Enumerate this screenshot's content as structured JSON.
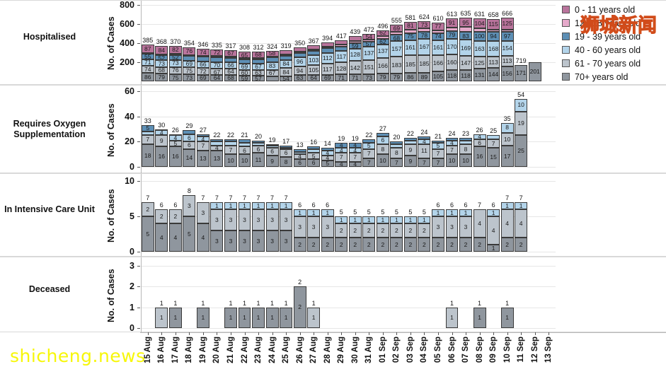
{
  "legend": {
    "title": "",
    "items": [
      {
        "label": "0 - 11 years old",
        "color": "#b9749c"
      },
      {
        "label": "12 - 18 years old",
        "color": "#e6aacb"
      },
      {
        "label": "19 - 39 years old",
        "color": "#5d8fb5"
      },
      {
        "label": "40 - 60 years old",
        "color": "#b3d4ea"
      },
      {
        "label": "61 - 70 years old",
        "color": "#bcc4cc"
      },
      {
        "label": "70+ years old",
        "color": "#8f969e"
      }
    ]
  },
  "watermarks": {
    "chinese": "狮城新闻",
    "site": "shicheng.news"
  },
  "panels": [
    {
      "title": "Hospitalised",
      "ylabel": "No. of Cases"
    },
    {
      "title": "Requires Oxygen Supplementation",
      "ylabel": "No. of Cases"
    },
    {
      "title": "In Intensive Care Unit",
      "ylabel": "No. of Cases"
    },
    {
      "title": "Deceased",
      "ylabel": "No. of Cases"
    }
  ],
  "chart_data": [
    {
      "type": "bar",
      "stacked": true,
      "title": "Hospitalised",
      "xlabel": "",
      "ylabel": "No. of Cases",
      "ylim": [
        0,
        800
      ],
      "yticks": [
        200,
        400,
        600,
        800
      ],
      "grid": true,
      "legend_position": "right",
      "categories": [
        "15 Aug",
        "16 Aug",
        "17 Aug",
        "18 Aug",
        "19 Aug",
        "20 Aug",
        "21 Aug",
        "22 Aug",
        "23 Aug",
        "24 Aug",
        "25 Aug",
        "26 Aug",
        "27 Aug",
        "28 Aug",
        "29 Aug",
        "30 Aug",
        "31 Aug",
        "01 Sep",
        "02 Sep",
        "03 Sep",
        "04 Sep",
        "05 Sep",
        "06 Sep",
        "07 Sep",
        "08 Sep",
        "09 Sep",
        "10 Sep",
        "11 Sep",
        "12 Sep",
        "13 Sep"
      ],
      "series": [
        {
          "name": "0 - 11 years old",
          "values": [
            87,
            84,
            82,
            76,
            74,
            72,
            67,
            65,
            68,
            58,
            47,
            42,
            45,
            46,
            47,
            51,
            54,
            62,
            69,
            81,
            73,
            77,
            91,
            95,
            104,
            115,
            125,
            null,
            null,
            null
          ]
        },
        {
          "name": "12 - 18 years old",
          "values": [
            12,
            11,
            12,
            12,
            11,
            12,
            12,
            10,
            10,
            11,
            12,
            12,
            13,
            14,
            17,
            20,
            22,
            31,
            34,
            37,
            38,
            31,
            38,
            51,
            37,
            19,
            22,
            null,
            null,
            null
          ]
        },
        {
          "name": "19 - 39 years old",
          "values": [
            55,
            52,
            52,
            48,
            49,
            50,
            49,
            45,
            46,
            51,
            44,
            46,
            46,
            48,
            49,
            59,
            57,
            62,
            68,
            75,
            78,
            74,
            79,
            83,
            100,
            94,
            97,
            null,
            null,
            null
          ]
        },
        {
          "name": "40 - 60 years old",
          "values": [
            71,
            73,
            73,
            69,
            66,
            70,
            66,
            69,
            67,
            83,
            84,
            96,
            103,
            112,
            117,
            128,
            137,
            137,
            157,
            161,
            167,
            161,
            170,
            169,
            163,
            168,
            154,
            null,
            null,
            null
          ]
        },
        {
          "name": "61 - 70 years old",
          "values": [
            74,
            68,
            76,
            75,
            72,
            67,
            64,
            60,
            63,
            67,
            84,
            94,
            105,
            117,
            128,
            142,
            151,
            166,
            183,
            185,
            185,
            166,
            160,
            147,
            125,
            113,
            113,
            null,
            null,
            null
          ]
        },
        {
          "name": "70+ years old",
          "values": [
            86,
            79,
            75,
            73,
            69,
            64,
            68,
            59,
            57,
            50,
            54,
            63,
            64,
            69,
            71,
            71,
            73,
            79,
            79,
            86,
            89,
            105,
            118,
            118,
            131,
            144,
            156,
            171,
            201,
            null
          ]
        }
      ],
      "totals": [
        385,
        368,
        370,
        354,
        346,
        335,
        317,
        308,
        312,
        324,
        319,
        350,
        367,
        394,
        417,
        439,
        472,
        496,
        555,
        581,
        624,
        610,
        613,
        635,
        631,
        658,
        666,
        719,
        null,
        null
      ]
    },
    {
      "type": "bar",
      "stacked": true,
      "title": "Requires Oxygen Supplementation",
      "xlabel": "",
      "ylabel": "No. of Cases",
      "ylim": [
        0,
        60
      ],
      "yticks": [
        0,
        20,
        40,
        60
      ],
      "grid": true,
      "categories": [
        "15 Aug",
        "16 Aug",
        "17 Aug",
        "18 Aug",
        "19 Aug",
        "20 Aug",
        "21 Aug",
        "22 Aug",
        "23 Aug",
        "24 Aug",
        "25 Aug",
        "26 Aug",
        "27 Aug",
        "28 Aug",
        "29 Aug",
        "30 Aug",
        "31 Aug",
        "01 Sep",
        "02 Sep",
        "03 Sep",
        "04 Sep",
        "05 Sep",
        "06 Sep",
        "07 Sep",
        "08 Sep",
        "09 Sep",
        "10 Sep",
        "11 Sep",
        "12 Sep",
        "13 Sep"
      ],
      "series": [
        {
          "name": "19 - 39 years old",
          "values": [
            5,
            1,
            1,
            3,
            2,
            2,
            2,
            3,
            2,
            1,
            2,
            2,
            2,
            2,
            4,
            4,
            3,
            3,
            2,
            2,
            2,
            2,
            2,
            2,
            null,
            null,
            null,
            null,
            null,
            null
          ]
        },
        {
          "name": "40 - 60 years old",
          "values": [
            3,
            4,
            4,
            6,
            4,
            3,
            3,
            3,
            2,
            2,
            1,
            2,
            3,
            4,
            4,
            4,
            5,
            6,
            3,
            3,
            4,
            5,
            4,
            3,
            4,
            3,
            8,
            10,
            null,
            null
          ]
        },
        {
          "name": "61 - 70 years old",
          "values": [
            7,
            9,
            5,
            6,
            7,
            4,
            7,
            6,
            6,
            6,
            6,
            4,
            5,
            4,
            7,
            7,
            7,
            8,
            8,
            9,
            11,
            7,
            7,
            8,
            6,
            7,
            10,
            19,
            null,
            null
          ]
        },
        {
          "name": "70+ years old",
          "values": [
            18,
            16,
            16,
            14,
            13,
            13,
            10,
            10,
            11,
            9,
            8,
            6,
            6,
            5,
            4,
            4,
            7,
            10,
            7,
            9,
            7,
            7,
            10,
            10,
            16,
            15,
            17,
            25,
            null,
            null
          ]
        }
      ],
      "totals": [
        33,
        30,
        26,
        29,
        27,
        22,
        22,
        21,
        20,
        19,
        17,
        13,
        16,
        14,
        19,
        19,
        22,
        27,
        20,
        22,
        24,
        21,
        24,
        23,
        26,
        25,
        35,
        54,
        null,
        null
      ]
    },
    {
      "type": "bar",
      "stacked": true,
      "title": "In Intensive Care Unit",
      "xlabel": "",
      "ylabel": "No. of Cases",
      "ylim": [
        0,
        10
      ],
      "yticks": [
        0,
        5,
        10
      ],
      "grid": true,
      "categories": [
        "15 Aug",
        "16 Aug",
        "17 Aug",
        "18 Aug",
        "19 Aug",
        "20 Aug",
        "21 Aug",
        "22 Aug",
        "23 Aug",
        "24 Aug",
        "25 Aug",
        "26 Aug",
        "27 Aug",
        "28 Aug",
        "29 Aug",
        "30 Aug",
        "31 Aug",
        "01 Sep",
        "02 Sep",
        "03 Sep",
        "04 Sep",
        "05 Sep",
        "06 Sep",
        "07 Sep",
        "08 Sep",
        "09 Sep",
        "10 Sep",
        "11 Sep",
        "12 Sep",
        "13 Sep"
      ],
      "series": [
        {
          "name": "40 - 60 years old",
          "values": [
            null,
            null,
            null,
            null,
            null,
            1,
            1,
            1,
            1,
            1,
            1,
            1,
            1,
            1,
            1,
            1,
            1,
            1,
            1,
            1,
            1,
            1,
            1,
            1,
            null,
            1,
            1,
            1,
            null,
            null
          ]
        },
        {
          "name": "61 - 70 years old",
          "values": [
            2,
            2,
            2,
            3,
            3,
            3,
            3,
            3,
            3,
            3,
            3,
            3,
            3,
            3,
            2,
            2,
            2,
            2,
            2,
            2,
            2,
            3,
            3,
            3,
            4,
            4,
            4,
            4,
            null,
            null
          ]
        },
        {
          "name": "70+ years old",
          "values": [
            5,
            4,
            4,
            5,
            4,
            3,
            3,
            3,
            3,
            3,
            3,
            2,
            2,
            2,
            2,
            2,
            2,
            2,
            2,
            2,
            2,
            2,
            2,
            2,
            2,
            1,
            2,
            2,
            null,
            null
          ]
        }
      ],
      "totals": [
        7,
        6,
        6,
        8,
        7,
        7,
        7,
        7,
        7,
        7,
        7,
        6,
        6,
        6,
        5,
        5,
        5,
        5,
        5,
        5,
        5,
        6,
        6,
        6,
        7,
        6,
        7,
        7,
        null,
        null
      ]
    },
    {
      "type": "bar",
      "stacked": true,
      "title": "Deceased",
      "xlabel": "",
      "ylabel": "No. of Cases",
      "ylim": [
        0,
        3
      ],
      "yticks": [
        0,
        1,
        2,
        3
      ],
      "grid": true,
      "categories": [
        "15 Aug",
        "16 Aug",
        "17 Aug",
        "18 Aug",
        "19 Aug",
        "20 Aug",
        "21 Aug",
        "22 Aug",
        "23 Aug",
        "24 Aug",
        "25 Aug",
        "26 Aug",
        "27 Aug",
        "28 Aug",
        "29 Aug",
        "30 Aug",
        "31 Aug",
        "01 Sep",
        "02 Sep",
        "03 Sep",
        "04 Sep",
        "05 Sep",
        "06 Sep",
        "07 Sep",
        "08 Sep",
        "09 Sep",
        "10 Sep",
        "11 Sep",
        "12 Sep",
        "13 Sep"
      ],
      "series": [
        {
          "name": "61 - 70 years old",
          "values": [
            null,
            1,
            null,
            null,
            null,
            null,
            null,
            null,
            null,
            null,
            null,
            null,
            1,
            null,
            null,
            null,
            null,
            null,
            null,
            null,
            null,
            null,
            1,
            null,
            null,
            null,
            null,
            null,
            null,
            null
          ]
        },
        {
          "name": "70+ years old",
          "values": [
            null,
            null,
            1,
            null,
            1,
            null,
            1,
            1,
            1,
            1,
            1,
            2,
            null,
            null,
            null,
            null,
            null,
            null,
            null,
            null,
            null,
            null,
            null,
            null,
            1,
            null,
            1,
            null,
            null,
            null
          ]
        }
      ],
      "totals": [
        null,
        1,
        1,
        null,
        1,
        null,
        1,
        1,
        1,
        1,
        1,
        2,
        1,
        null,
        null,
        null,
        null,
        null,
        null,
        null,
        null,
        null,
        1,
        null,
        1,
        null,
        1,
        null,
        null,
        null
      ]
    }
  ]
}
